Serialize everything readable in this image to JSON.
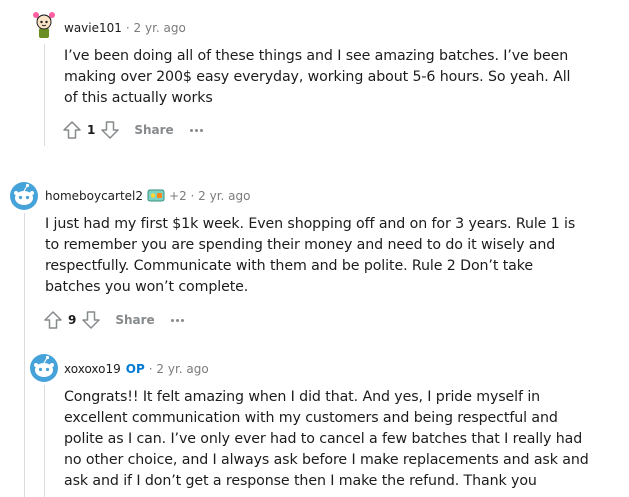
{
  "comments": [
    {
      "username": "wavie101",
      "meta": "· 2 yr. ago",
      "body": "I’ve been doing all of these things and I see amazing batches. I’ve been making over 200$ easy everyday, working about 5-6 hours. So yeah. All of this actually works",
      "votes": "1",
      "share_label": "Share"
    },
    {
      "username": "homeboycartel2",
      "meta": "+2 · 2 yr. ago",
      "body": "I just had my first $1k week. Even shopping off and on for 3 years. Rule 1 is to remember you are spending their money and need to do it wisely and respectfully. Communicate with them and be polite. Rule 2 Don’t take batches you won’t complete.",
      "votes": "9",
      "share_label": "Share"
    },
    {
      "username": "xoxoxo19",
      "op_tag": "OP",
      "meta": "· 2 yr. ago",
      "body": "Congrats!! It felt amazing when I did that. And yes, I pride myself in excellent communication with my customers and being respectful and polite as I can. I’ve only ever had to cancel a few batches that I really had no other choice, and I always ask before I make replacements and ask and ask and if I don’t get a response then I make the refund. Thank you"
    }
  ],
  "icons": {
    "upvote": "upvote-arrow-icon",
    "downvote": "downvote-arrow-icon",
    "more": "ellipsis-icon"
  },
  "colors": {
    "op_tag": "#0079d3",
    "muted": "#878a8c",
    "thread_line": "#dcdcdc",
    "snoo_blue": "#46a3d9"
  }
}
